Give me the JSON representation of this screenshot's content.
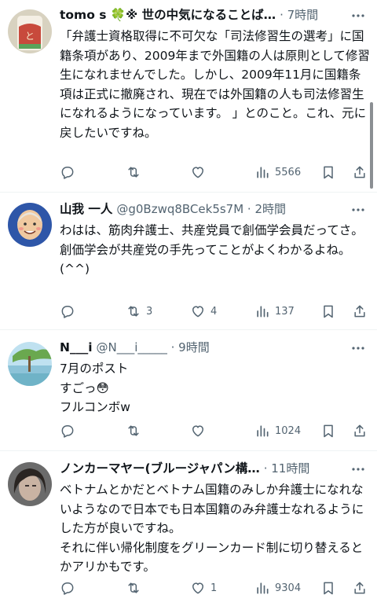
{
  "posts": [
    {
      "name": "tomo s 🍀※ 世の中気になることば…",
      "meta": "· 7時間",
      "text": "「弁護士資格取得に不可欠な「司法修習生の選考」に国籍条項があり、2009年まで外国籍の人は原則として修習生になれませんでした。しかし、2009年11月に国籍条項は正式に撤廃され、現在では外国籍の人も司法修習生になれるようになっています。 」とのこと。これ、元に戻したいですね。",
      "retweets": "",
      "likes": "",
      "views": "5566"
    },
    {
      "name": "山我 一人",
      "meta": "@g0Bzwq8BCek5s7M · 2時間",
      "text": "わはは、筋肉弁護士、共産党員で創価学会員だってさ。\n創価学会が共産党の手先ってことがよくわかるよね。(^^)",
      "retweets": "3",
      "likes": "4",
      "views": "137"
    },
    {
      "name": "N___i",
      "meta": "@N___i_____ · 9時間",
      "text": "7月のポスト\nすごっ😳\nフルコンボw",
      "retweets": "",
      "likes": "",
      "views": "1024"
    },
    {
      "name": "ノンカーマヤー(ブルージャパン構…",
      "meta": "· 11時間",
      "text": "ベトナムとかだとベトナム国籍のみしか弁護士になれないようなので日本でも日本国籍のみ弁護士なれるようにした方が良いですね。\nそれに伴い帰化制度をグリーンカード制に切り替えるとかアリかもです。",
      "retweets": "",
      "likes": "1",
      "views": "9304"
    }
  ],
  "colors": {
    "text": "#0f1419",
    "muted": "#536471",
    "divider": "#eff3f4"
  },
  "icons": [
    "reply-icon",
    "retweet-icon",
    "like-icon",
    "views-icon",
    "bookmark-icon",
    "share-icon",
    "more-icon"
  ]
}
